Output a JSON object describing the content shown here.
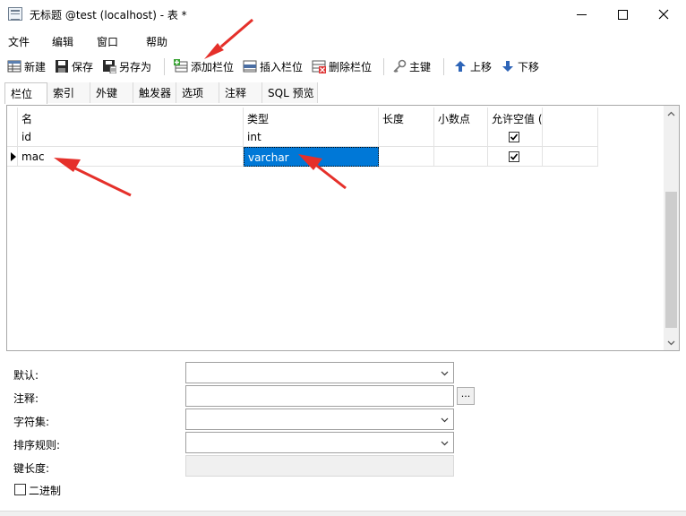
{
  "window": {
    "title": "无标题 @test (localhost) - 表 *"
  },
  "menu": {
    "items": [
      "文件",
      "编辑",
      "窗口",
      "帮助"
    ]
  },
  "toolbar": {
    "new": "新建",
    "save": "保存",
    "save_as": "另存为",
    "add_field": "添加栏位",
    "insert_field": "插入栏位",
    "delete_field": "删除栏位",
    "primary_key": "主键",
    "move_up": "上移",
    "move_down": "下移"
  },
  "tabs": [
    "栏位",
    "索引",
    "外键",
    "触发器",
    "选项",
    "注释",
    "SQL 预览"
  ],
  "grid": {
    "headers": [
      "名",
      "类型",
      "长度",
      "小数点",
      "允许空值 ("
    ],
    "rows": [
      {
        "name": "id",
        "type": "int",
        "length": "",
        "decimals": "",
        "allow_null": true
      },
      {
        "name": "mac",
        "type": "varchar",
        "length": "",
        "decimals": "",
        "allow_null": true
      }
    ]
  },
  "properties": {
    "default_label": "默认:",
    "comment_label": "注释:",
    "charset_label": "字符集:",
    "collation_label": "排序规则:",
    "key_length_label": "键长度:",
    "binary_label": "二进制",
    "ellipsis": "..."
  },
  "colors": {
    "selection": "#0078d7",
    "annotation_arrow": "#e5302a"
  }
}
